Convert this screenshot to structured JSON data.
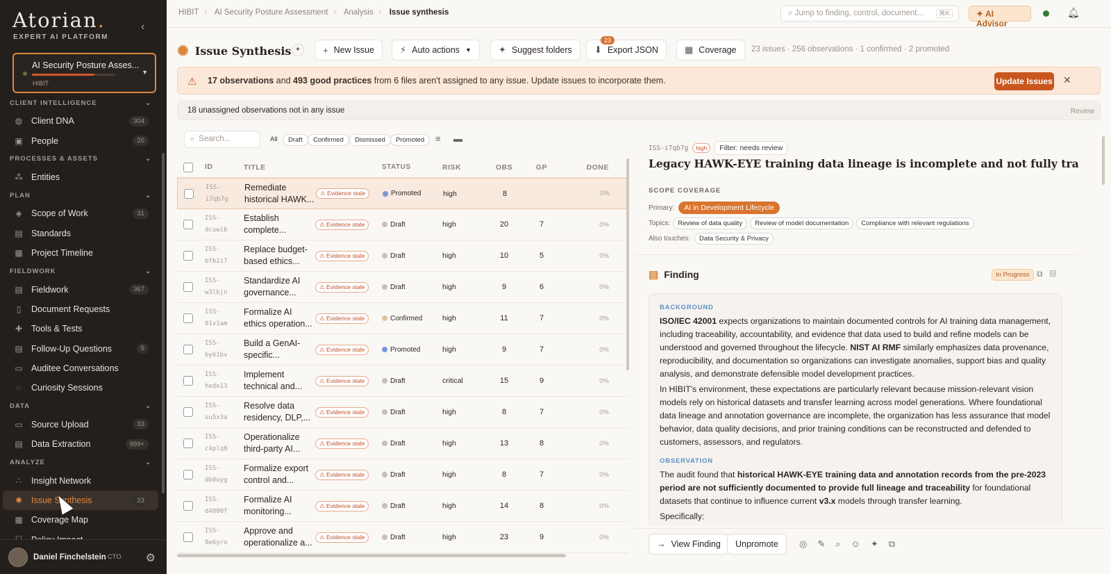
{
  "sidebar": {
    "logo": "Atorian",
    "logo_sub": "EXPERT AI PLATFORM",
    "project_name": "AI Security Posture Asses...",
    "project_org": "HIBIT",
    "sections": [
      {
        "title": "CLIENT INTELLIGENCE",
        "items": [
          {
            "label": "Client DNA",
            "count": "304",
            "icon": "dna-icon"
          },
          {
            "label": "People",
            "count": "20",
            "icon": "people-icon"
          }
        ]
      },
      {
        "title": "PROCESSES & ASSETS",
        "items": [
          {
            "label": "Entities",
            "count": "",
            "icon": "network-icon"
          }
        ]
      },
      {
        "title": "PLAN",
        "items": [
          {
            "label": "Scope of Work",
            "count": "31",
            "icon": "scope-icon"
          },
          {
            "label": "Standards",
            "count": "",
            "icon": "standards-icon"
          },
          {
            "label": "Project Timeline",
            "count": "",
            "icon": "calendar-icon"
          }
        ]
      },
      {
        "title": "FIELDWORK",
        "items": [
          {
            "label": "Fieldwork",
            "count": "367",
            "icon": "fieldwork-icon"
          },
          {
            "label": "Document Requests",
            "count": "",
            "icon": "document-icon"
          },
          {
            "label": "Tools & Tests",
            "count": "",
            "icon": "wrench-icon"
          },
          {
            "label": "Follow-Up Questions",
            "count": "5",
            "icon": "question-icon"
          },
          {
            "label": "Auditee Conversations",
            "count": "",
            "icon": "chat-icon"
          },
          {
            "label": "Curiosity Sessions",
            "count": "",
            "icon": "lightbulb-icon"
          }
        ]
      },
      {
        "title": "DATA",
        "items": [
          {
            "label": "Source Upload",
            "count": "33",
            "icon": "folder-icon"
          },
          {
            "label": "Data Extraction",
            "count": "999+",
            "icon": "extraction-icon"
          }
        ]
      },
      {
        "title": "ANALYZE",
        "items": [
          {
            "label": "Insight Network",
            "count": "",
            "icon": "insight-icon"
          },
          {
            "label": "Issue Synthesis",
            "count": "23",
            "icon": "synthesis-icon",
            "active": true
          },
          {
            "label": "Coverage Map",
            "count": "",
            "icon": "grid-icon"
          },
          {
            "label": "Policy Impact",
            "count": "",
            "icon": "shield-icon"
          }
        ]
      }
    ],
    "user_name": "Daniel Finchelstein",
    "user_role": "CTO"
  },
  "topbar": {
    "crumbs": [
      "HIBIT",
      "AI Security Posture Assessment",
      "Analysis",
      "Issue synthesis"
    ],
    "jump_placeholder": "Jump to finding, control, document...",
    "jump_kbd": "⌘K",
    "advisor": "AI Advisor"
  },
  "toolbar": {
    "title": "Issue Synthesis",
    "new_issue": "New Issue",
    "auto_actions": "Auto actions",
    "suggest_folders": "Suggest folders",
    "export_json": "Export JSON",
    "export_badge": "23",
    "coverage": "Coverage",
    "stats": "23 issues · 256 observations · 1 confirmed · 2 promoted"
  },
  "banner": {
    "obs": "17 observations",
    "and": " and ",
    "gp": "493 good practices",
    "rest": " from 6 files aren't assigned to any issue. Update issues to incorporate them.",
    "button": "Update Issues"
  },
  "unassigned": {
    "text": "18 unassigned observations not in any issue",
    "review": "Review"
  },
  "filters": {
    "search_placeholder": "Search...",
    "chips": [
      "All",
      "Draft",
      "Confirmed",
      "Dismissed",
      "Promoted"
    ]
  },
  "table": {
    "headers": [
      "ID",
      "TITLE",
      "STATUS",
      "RISK",
      "OBS",
      "GP",
      "DONE"
    ],
    "stale_label": "Evidence stale",
    "rows": [
      {
        "id1": "ISS-",
        "id2": "i7qb7g",
        "title": "Remediate historical HAWK...",
        "status": "Promoted",
        "status_color": "#7a98d8",
        "risk": "high",
        "obs": "8",
        "gp": "",
        "done": "0%",
        "selected": true
      },
      {
        "id1": "ISS-",
        "id2": "dcuwib",
        "title": "Establish complete...",
        "status": "Draft",
        "status_color": "#c9bfb5",
        "risk": "high",
        "obs": "20",
        "gp": "7",
        "done": "0%"
      },
      {
        "id1": "ISS-",
        "id2": "bfb2i7",
        "title": "Replace budget-based ethics...",
        "status": "Draft",
        "status_color": "#c9bfb5",
        "risk": "high",
        "obs": "10",
        "gp": "5",
        "done": "0%"
      },
      {
        "id1": "ISS-",
        "id2": "w3lbjn",
        "title": "Standardize AI governance...",
        "status": "Draft",
        "status_color": "#c9bfb5",
        "risk": "high",
        "obs": "9",
        "gp": "6",
        "done": "0%"
      },
      {
        "id1": "ISS-",
        "id2": "01v1am",
        "title": "Formalize AI ethics operation...",
        "status": "Confirmed",
        "status_color": "#d9c4a6",
        "risk": "high",
        "obs": "11",
        "gp": "7",
        "done": "0%"
      },
      {
        "id1": "ISS-",
        "id2": "by61bv",
        "title": "Build a GenAI-specific...",
        "status": "Promoted",
        "status_color": "#7a98d8",
        "risk": "high",
        "obs": "9",
        "gp": "7",
        "done": "0%"
      },
      {
        "id1": "ISS-",
        "id2": "hedo13",
        "title": "Implement technical and...",
        "status": "Draft",
        "status_color": "#c9bfb5",
        "risk": "critical",
        "obs": "15",
        "gp": "9",
        "done": "0%"
      },
      {
        "id1": "ISS-",
        "id2": "su5x3a",
        "title": "Resolve data residency, DLP,...",
        "status": "Draft",
        "status_color": "#c9bfb5",
        "risk": "high",
        "obs": "8",
        "gp": "7",
        "done": "0%"
      },
      {
        "id1": "ISS-",
        "id2": "c4plq8",
        "title": "Operationalize third-party AI...",
        "status": "Draft",
        "status_color": "#c9bfb5",
        "risk": "high",
        "obs": "13",
        "gp": "8",
        "done": "0%"
      },
      {
        "id1": "ISS-",
        "id2": "db0uyg",
        "title": "Formalize export control and...",
        "status": "Draft",
        "status_color": "#c9bfb5",
        "risk": "high",
        "obs": "8",
        "gp": "7",
        "done": "0%"
      },
      {
        "id1": "ISS-",
        "id2": "d4080f",
        "title": "Formalize AI monitoring...",
        "status": "Draft",
        "status_color": "#c9bfb5",
        "risk": "high",
        "obs": "14",
        "gp": "8",
        "done": "0%"
      },
      {
        "id1": "ISS-",
        "id2": "8e6yro",
        "title": "Approve and operationalize a...",
        "status": "Draft",
        "status_color": "#c9bfb5",
        "risk": "high",
        "obs": "23",
        "gp": "9",
        "done": "0%"
      }
    ]
  },
  "detail": {
    "id": "ISS-i7qb7g",
    "risk": "high",
    "filter": "Filter: needs review",
    "title": "Legacy HAWK-EYE training data lineage is incomplete and not fully traceable",
    "scope_heading": "SCOPE COVERAGE",
    "primary_label": "Primary:",
    "primary": "AI in Development Lifecycle",
    "topics_label": "Topics:",
    "topics": [
      "Review of data quality",
      "Review of model documentation",
      "Compliance with relevant regulations"
    ],
    "also_label": "Also touches:",
    "also": "Data Security & Privacy",
    "finding_label": "Finding",
    "progress": "In Progress",
    "background_h": "BACKGROUND",
    "bg1_b1": "ISO/IEC 42001",
    "bg1_t1": " expects organizations to maintain documented controls for AI training data management, including traceability, accountability, and evidence that data used to build and refine models can be understood and governed throughout the lifecycle. ",
    "bg1_b2": "NIST AI RMF",
    "bg1_t2": " similarly emphasizes data provenance, reproducibility, and documentation so organizations can investigate anomalies, support bias and quality analysis, and demonstrate defensible model development practices.",
    "bg2": "In HIBIT's environment, these expectations are particularly relevant because mission-relevant vision models rely on historical datasets and transfer learning across model generations. Where foundational data lineage and annotation governance are incomplete, the organization has less assurance that model behavior, data quality decisions, and prior training conditions can be reconstructed and defended to customers, assessors, and regulators.",
    "observation_h": "OBSERVATION",
    "obs_t1": "The audit found that ",
    "obs_b1": "historical HAWK-EYE training data and annotation records from the pre-2023 period are not sufficiently documented to provide full lineage and traceability",
    "obs_t2": " for foundational datasets that continue to influence current ",
    "obs_b2": "v3.x",
    "obs_t3": " models through transfer learning.",
    "specifically": "Specifically:",
    "view_finding": "View Finding",
    "unpromote": "Unpromote"
  }
}
